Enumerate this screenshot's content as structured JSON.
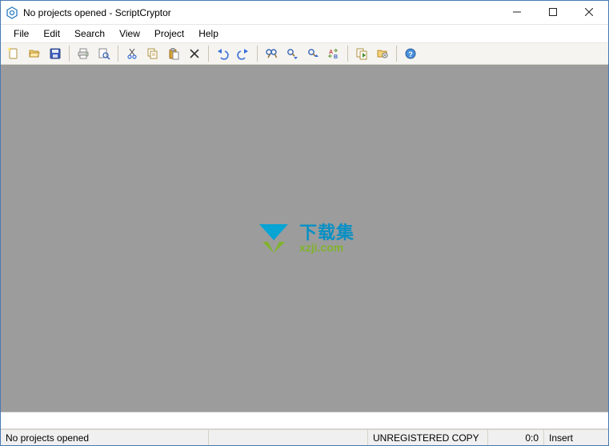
{
  "title": "No projects opened - ScriptCryptor",
  "menu": {
    "file": "File",
    "edit": "Edit",
    "search": "Search",
    "view": "View",
    "project": "Project",
    "help": "Help"
  },
  "watermark": {
    "cn": "下载集",
    "en": "xzji.com"
  },
  "status": {
    "main": "No projects opened",
    "registration": "UNREGISTERED COPY",
    "position": "0:0",
    "mode": "Insert"
  }
}
